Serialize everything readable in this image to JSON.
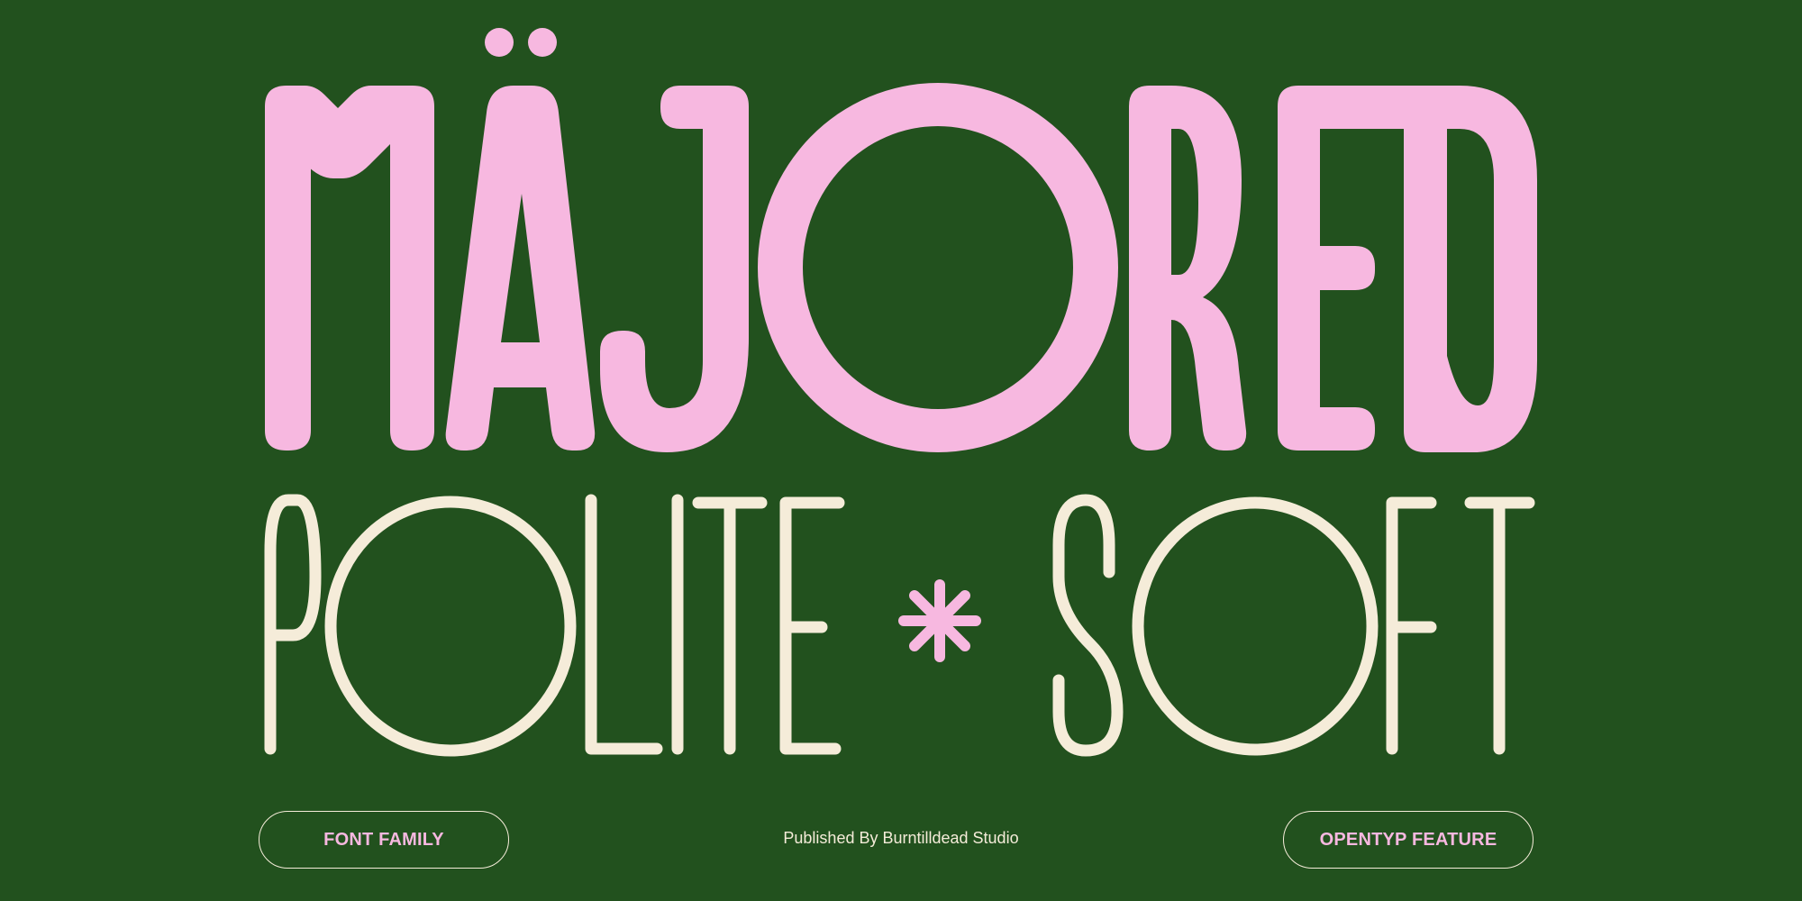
{
  "headline": {
    "text": "MÄJORED",
    "color": "#f7b8e0"
  },
  "subline": {
    "left": "POLITE",
    "separator": "*",
    "right": "SOFT",
    "color": "#f5ecd9"
  },
  "background": "#22511e",
  "footer": {
    "left_button": "FONT FAMILY",
    "publisher": "Published By Burntilldead Studio",
    "right_button": "OPENTYP FEATURE"
  }
}
